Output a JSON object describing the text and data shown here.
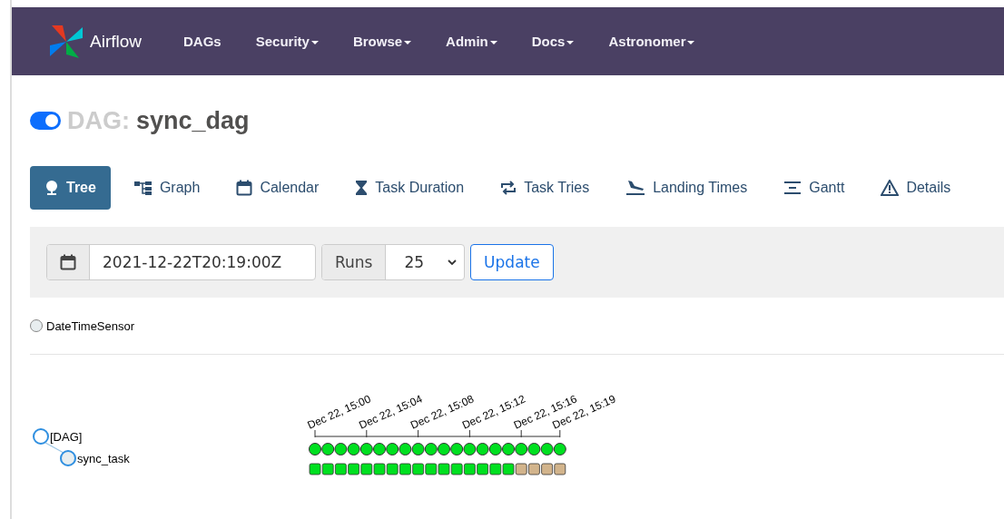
{
  "navbar": {
    "brand": "Airflow",
    "items": [
      {
        "label": "DAGs",
        "dropdown": false
      },
      {
        "label": "Security",
        "dropdown": true
      },
      {
        "label": "Browse",
        "dropdown": true
      },
      {
        "label": "Admin",
        "dropdown": true
      },
      {
        "label": "Docs",
        "dropdown": true
      },
      {
        "label": "Astronomer",
        "dropdown": true
      }
    ]
  },
  "dag": {
    "prefix": "DAG:",
    "name": "sync_dag",
    "on": true
  },
  "tabs": [
    {
      "label": "Tree",
      "kind": "tree",
      "selected": true
    },
    {
      "label": "Graph",
      "kind": "graph",
      "selected": false
    },
    {
      "label": "Calendar",
      "kind": "calendar",
      "selected": false
    },
    {
      "label": "Task Duration",
      "kind": "duration",
      "selected": false
    },
    {
      "label": "Task Tries",
      "kind": "tries",
      "selected": false
    },
    {
      "label": "Landing Times",
      "kind": "landing",
      "selected": false
    },
    {
      "label": "Gantt",
      "kind": "gantt",
      "selected": false
    },
    {
      "label": "Details",
      "kind": "details",
      "selected": false
    }
  ],
  "filter": {
    "base_date": "2021-12-22T20:19:00Z",
    "runs_label": "Runs",
    "runs_value": "25",
    "button": "Update"
  },
  "legend": [
    {
      "label": "DateTimeSensor",
      "color": "#e8eef0"
    }
  ],
  "tree": {
    "nodes": [
      {
        "label": "[DAG]",
        "children": [
          {
            "label": "sync_task"
          }
        ]
      }
    ],
    "time_labels": [
      "Dec 22, 15:00",
      "Dec 22, 15:04",
      "Dec 22, 15:08",
      "Dec 22, 15:12",
      "Dec 22, 15:16",
      "Dec 22, 15:19"
    ],
    "dag_runs": [
      {
        "color": "#00e020"
      },
      {
        "color": "#00e020"
      },
      {
        "color": "#00e020"
      },
      {
        "color": "#00e020"
      },
      {
        "color": "#00e020"
      },
      {
        "color": "#00e020"
      },
      {
        "color": "#00e020"
      },
      {
        "color": "#00e020"
      },
      {
        "color": "#00e020"
      },
      {
        "color": "#00e020"
      },
      {
        "color": "#00e020"
      },
      {
        "color": "#00e020"
      },
      {
        "color": "#00e020"
      },
      {
        "color": "#00e020"
      },
      {
        "color": "#00e020"
      },
      {
        "color": "#00e020"
      },
      {
        "color": "#00e020"
      },
      {
        "color": "#00e020"
      },
      {
        "color": "#00e020"
      },
      {
        "color": "#00e020"
      }
    ],
    "task_instances": [
      {
        "color": "#00e020"
      },
      {
        "color": "#00e020"
      },
      {
        "color": "#00e020"
      },
      {
        "color": "#00e020"
      },
      {
        "color": "#00e020"
      },
      {
        "color": "#00e020"
      },
      {
        "color": "#00e020"
      },
      {
        "color": "#00e020"
      },
      {
        "color": "#00e020"
      },
      {
        "color": "#00e020"
      },
      {
        "color": "#00e020"
      },
      {
        "color": "#00e020"
      },
      {
        "color": "#00e020"
      },
      {
        "color": "#00e020"
      },
      {
        "color": "#00e020"
      },
      {
        "color": "#00e020"
      },
      {
        "color": "#d2b48c"
      },
      {
        "color": "#d2b48c"
      },
      {
        "color": "#d2b48c"
      },
      {
        "color": "#d2b48c"
      }
    ]
  }
}
